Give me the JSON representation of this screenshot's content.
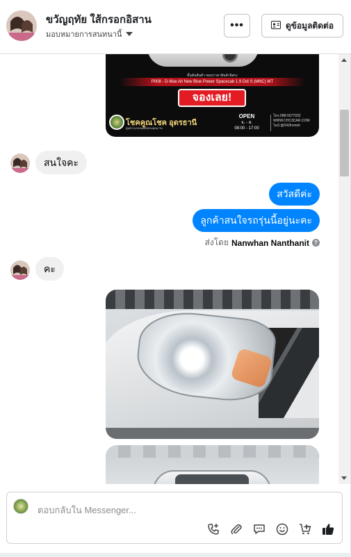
{
  "header": {
    "name": "ขวัญฤทัย ใส้กรอกอิสาน",
    "assign_label": "มอบหมายการสนทนานี้",
    "more_label": "•••",
    "contact_button_label": "ดูข้อมูลติดต่อ"
  },
  "ad": {
    "line1": "ขั้นต้นสินค้า-ขอบราคาสินค้าอิสระ",
    "model": "P008 - D-Max All New Blue Power Spacecab 1.9 Ddi S (MNC) MT",
    "cta": "จองเลย!",
    "brand": "โชคคูณโชค อุดรธานี",
    "brand_sub": "ศูนย์รวมรถยนต์มือสองคุณภาพ",
    "open_title": "OPEN",
    "open_days": "จ. - ส.",
    "open_hours": "08:00 - 17:00",
    "contact_lines": [
      "โทร.088-5577932",
      "WWW.CHC3CAR.COM",
      "ไลน์ @042frvmnh"
    ]
  },
  "messages": [
    {
      "from": "customer",
      "text": "สนใจคะ"
    },
    {
      "from": "page",
      "text": "สวัสดีค่ะ"
    },
    {
      "from": "page",
      "text": "ลูกค้าสนใจรถรุ่นนี้อยู่นะคะ"
    },
    {
      "from": "customer",
      "text": "คะ"
    }
  ],
  "sent_by": {
    "prefix": "ส่งโดย",
    "name": "Nanwhan Nanthanit",
    "help": "?"
  },
  "composer": {
    "placeholder": "ตอบกลับใน Messenger..."
  },
  "icons": {
    "composer": [
      "add-call-icon",
      "paperclip-icon",
      "saved-reply-icon",
      "emoji-icon",
      "add-product-icon",
      "like-icon"
    ]
  },
  "colors": {
    "accent": "#0084ff",
    "incoming_bubble": "#f0f0f0"
  }
}
